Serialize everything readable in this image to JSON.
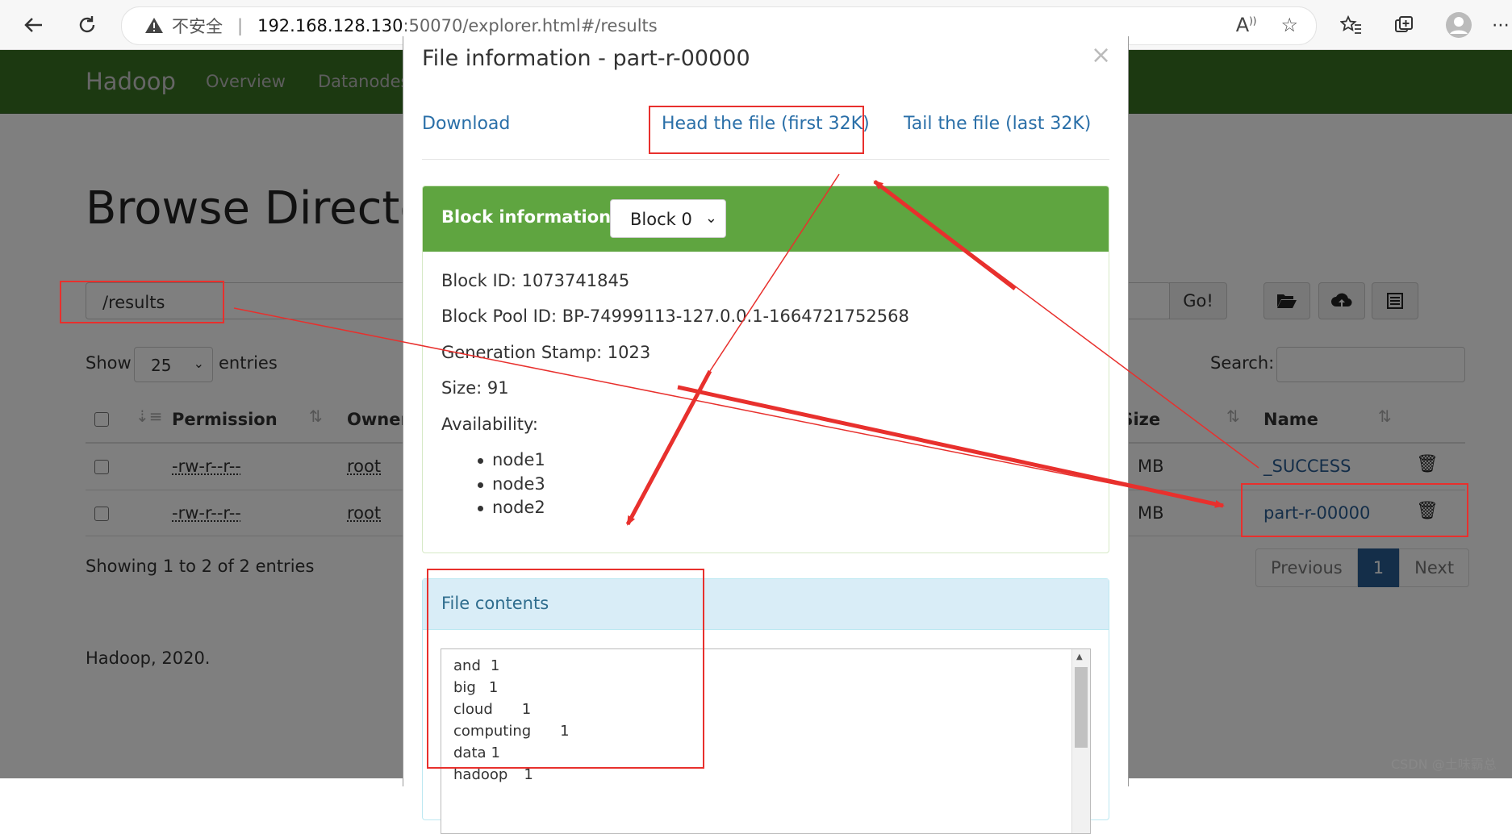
{
  "browser": {
    "insecure_label": "不安全",
    "url_host": "192.168.128.130",
    "url_rest": ":50070/explorer.html#/results"
  },
  "navbar": {
    "brand": "Hadoop",
    "items": [
      "Overview",
      "Datanodes"
    ]
  },
  "page": {
    "title": "Browse Directory",
    "path_value": "/results",
    "go_label": "Go!",
    "show_label": "Show",
    "entries_value": "25",
    "entries_label": "entries",
    "search_label": "Search:",
    "columns": {
      "permission": "Permission",
      "owner": "Owner",
      "block_size": "Block Size",
      "name": "Name"
    },
    "rows": [
      {
        "permission": "-rw-r--r--",
        "owner": "root",
        "block_size": "MB",
        "name": "_SUCCESS"
      },
      {
        "permission": "-rw-r--r--",
        "owner": "root",
        "block_size": "MB",
        "name": "part-r-00000"
      }
    ],
    "showing": "Showing 1 to 2 of 2 entries",
    "pagination": {
      "previous": "Previous",
      "current": "1",
      "next": "Next"
    },
    "footer": "Hadoop, 2020."
  },
  "modal": {
    "title": "File information - part-r-00000",
    "close": "×",
    "links": {
      "download": "Download",
      "head": "Head the file (first 32K)",
      "tail": "Tail the file (last 32K)"
    },
    "block_panel": {
      "heading": "Block information --",
      "selected_block": "Block 0",
      "block_id": "Block ID: 1073741845",
      "block_pool_id": "Block Pool ID: BP-74999113-127.0.0.1-1664721752568",
      "generation_stamp": "Generation Stamp: 1023",
      "size": "Size: 91",
      "availability_label": "Availability:",
      "nodes": [
        "node1",
        "node3",
        "node2"
      ]
    },
    "contents_panel": {
      "heading": "File contents",
      "lines": [
        {
          "word": "and",
          "count": "1"
        },
        {
          "word": "big",
          "count": "1"
        },
        {
          "word": "cloud",
          "count": "1"
        },
        {
          "word": "computing",
          "count": "1"
        },
        {
          "word": "data",
          "count": "1"
        },
        {
          "word": "hadoop",
          "count": "1"
        }
      ]
    }
  },
  "annotation_color": "#e8302d",
  "watermark": "CSDN @土味霸总"
}
